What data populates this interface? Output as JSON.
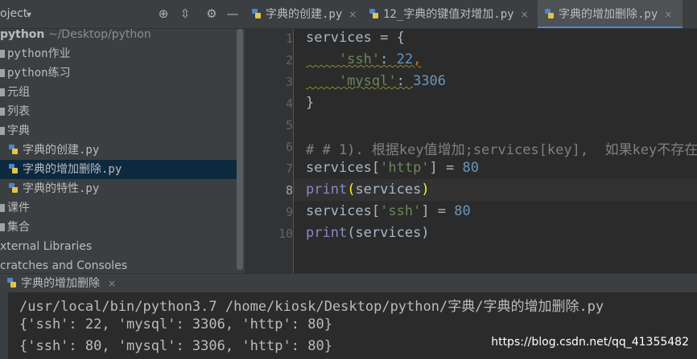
{
  "sidebar": {
    "title": "oject",
    "tree": [
      {
        "name": "python",
        "path": "~/Desktop/python",
        "kind": "root"
      },
      {
        "name": "python作业",
        "kind": "folder"
      },
      {
        "name": "python练习",
        "kind": "folder"
      },
      {
        "name": "元组",
        "kind": "folder"
      },
      {
        "name": "列表",
        "kind": "folder"
      },
      {
        "name": "字典",
        "kind": "folder"
      },
      {
        "name": "字典的创建.py",
        "kind": "file"
      },
      {
        "name": "字典的增加删除.py",
        "kind": "file",
        "selected": true
      },
      {
        "name": "字典的特性.py",
        "kind": "file"
      },
      {
        "name": "课件",
        "kind": "folder"
      },
      {
        "name": "集合",
        "kind": "folder"
      },
      {
        "name": "xternal Libraries",
        "kind": "item"
      },
      {
        "name": "cratches and Consoles",
        "kind": "item"
      }
    ]
  },
  "tabs": [
    {
      "label": "字典的创建.py",
      "close": "×"
    },
    {
      "label": "12_字典的键值对增加.py",
      "close": "×"
    },
    {
      "label": "字典的增加删除.py",
      "close": "×",
      "active": true
    }
  ],
  "editor": {
    "line_numbers": [
      "1",
      "2",
      "3",
      "4",
      "5",
      "6",
      "7",
      "8",
      "9",
      "10"
    ],
    "current_line": "8",
    "lines": [
      [
        "services = {"
      ],
      [
        "    'ssh'",
        ": ",
        "22",
        ","
      ],
      [
        "    'mysql'",
        ": ",
        "3306"
      ],
      [
        "}"
      ],
      [
        ""
      ],
      [
        "# # 1). 根据key值增加;services[key],  如果key不存在"
      ],
      [
        "services[",
        "'http'",
        "] = ",
        "80"
      ],
      [
        "print",
        "(",
        "services",
        ")"
      ],
      [
        "services[",
        "'ssh'",
        "] = ",
        "80"
      ],
      [
        "print",
        "(services)"
      ]
    ]
  },
  "run": {
    "tab_label": "字典的增加删除",
    "tab_close": "×",
    "output": [
      "/usr/local/bin/python3.7 /home/kiosk/Desktop/python/字典/字典的增加删除.py",
      "{'ssh': 22, 'mysql': 3306, 'http': 80}",
      "{'ssh': 80, 'mysql': 3306, 'http': 80}"
    ]
  },
  "watermark": "https://blog.csdn.net/qq_41355482",
  "colors": {
    "background": "#2b2b2b",
    "panel": "#3c3f41",
    "selection": "#0d293e",
    "accent": "#4a88c7",
    "string": "#6a8759",
    "number": "#6897bb",
    "comment": "#808080",
    "builtin": "#8888c6"
  }
}
